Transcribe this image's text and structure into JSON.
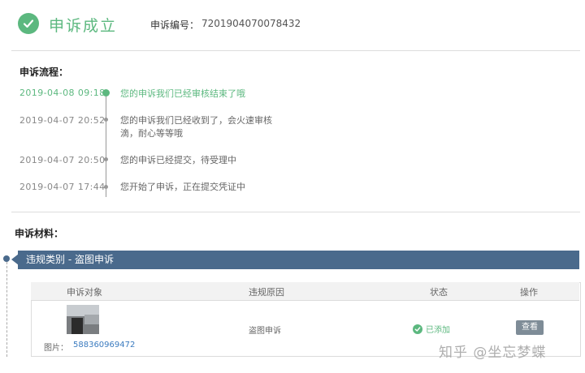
{
  "header": {
    "title": "申诉成立",
    "case_label": "申诉编号：",
    "case_number": "7201904070078432"
  },
  "process": {
    "title": "申诉流程：",
    "events": [
      {
        "time": "2019-04-08  09:18",
        "text": "您的申诉我们已经审核结束了哦",
        "active": true
      },
      {
        "time": "2019-04-07  20:52",
        "text_line1": "您的申诉我们已经收到了，会火速审核",
        "text_line2": "滴，耐心等等哦",
        "active": false
      },
      {
        "time": "2019-04-07  20:50",
        "text": "您的申诉已经提交，待受理中",
        "active": false
      },
      {
        "time": "2019-04-07  17:44",
        "text": "您开始了申诉，正在提交凭证中",
        "active": false
      }
    ]
  },
  "materials": {
    "title": "申诉材料：",
    "banner": "违规类别 - 盗图申诉",
    "table": {
      "headers": [
        "申诉对象",
        "违规原因",
        "状态",
        "操作"
      ],
      "row": {
        "image_label": "图片：",
        "image_id": "588360969472",
        "reason": "盗图申诉",
        "status": "已添加",
        "action": "查看"
      }
    }
  },
  "watermark": "知乎 @坐忘梦蝶",
  "colors": {
    "accent_green": "#5cb87f",
    "banner_blue": "#4a6a8c",
    "link_blue": "#3b7bbf"
  }
}
